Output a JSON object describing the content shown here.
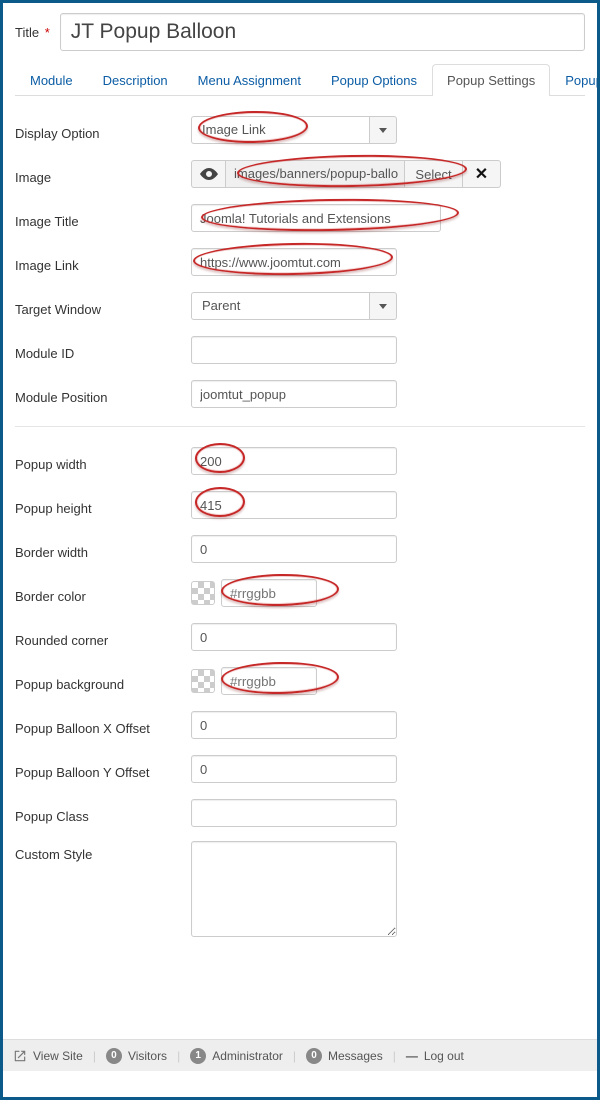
{
  "title": {
    "label": "Title",
    "required_mark": "*",
    "value": "JT Popup Balloon"
  },
  "tabs": {
    "items": [
      {
        "label": "Module"
      },
      {
        "label": "Description"
      },
      {
        "label": "Menu Assignment"
      },
      {
        "label": "Popup Options"
      },
      {
        "label": "Popup Settings"
      },
      {
        "label": "Popup"
      }
    ],
    "active_index": 4
  },
  "group1": {
    "display_option": {
      "label": "Display Option",
      "value": "Image Link"
    },
    "image": {
      "label": "Image",
      "path": "images/banners/popup-ballo",
      "select_label": "Select"
    },
    "image_title": {
      "label": "Image Title",
      "value": "Joomla! Tutorials and Extensions"
    },
    "image_link": {
      "label": "Image Link",
      "value": "https://www.joomtut.com"
    },
    "target_window": {
      "label": "Target Window",
      "value": "Parent"
    },
    "module_id": {
      "label": "Module ID",
      "value": ""
    },
    "module_position": {
      "label": "Module Position",
      "value": "joomtut_popup"
    }
  },
  "group2": {
    "popup_width": {
      "label": "Popup width",
      "value": "200"
    },
    "popup_height": {
      "label": "Popup height",
      "value": "415"
    },
    "border_width": {
      "label": "Border width",
      "value": "0"
    },
    "border_color": {
      "label": "Border color",
      "placeholder": "#rrggbb"
    },
    "rounded_corner": {
      "label": "Rounded corner",
      "value": "0"
    },
    "popup_background": {
      "label": "Popup background",
      "placeholder": "#rrggbb"
    },
    "x_offset": {
      "label": "Popup Balloon X Offset",
      "value": "0"
    },
    "y_offset": {
      "label": "Popup Balloon Y Offset",
      "value": "0"
    },
    "popup_class": {
      "label": "Popup Class",
      "value": ""
    },
    "custom_style": {
      "label": "Custom Style",
      "value": ""
    }
  },
  "statusbar": {
    "view_site": "View Site",
    "visitors": {
      "count": "0",
      "label": "Visitors"
    },
    "admins": {
      "count": "1",
      "label": "Administrator"
    },
    "messages": {
      "count": "0",
      "label": "Messages"
    },
    "logout": "Log out"
  }
}
